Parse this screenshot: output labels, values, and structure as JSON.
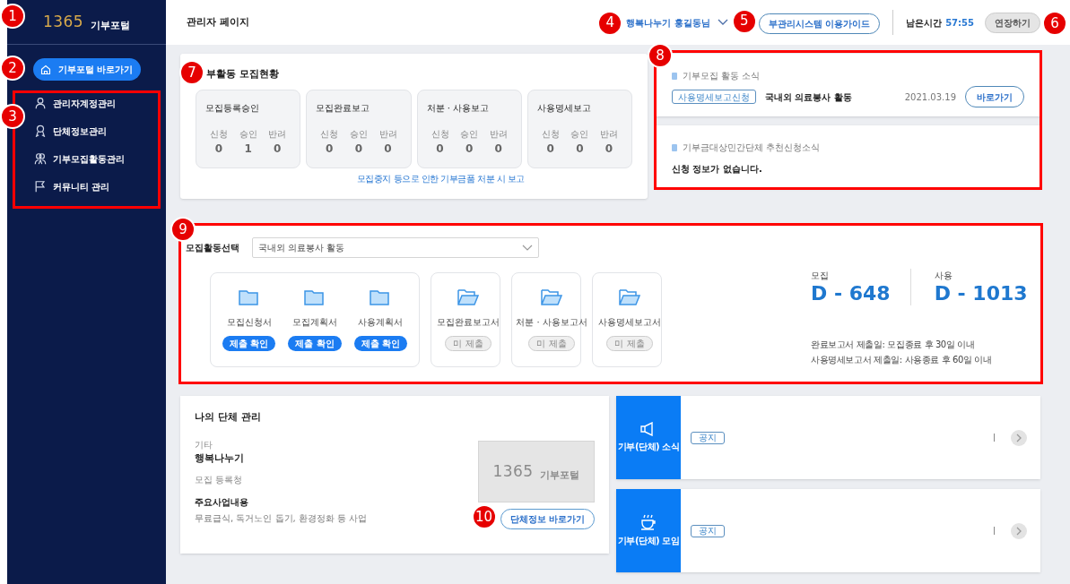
{
  "sidebar": {
    "logo": {
      "number": "1365",
      "text": "기부포털"
    },
    "portal_button": "기부포털 바로가기",
    "menu": [
      {
        "kind": "account",
        "label": "관리자계정관리"
      },
      {
        "kind": "organization",
        "label": "단체정보관리"
      },
      {
        "kind": "campaign",
        "label": "기부모집활동관리"
      },
      {
        "kind": "community",
        "label": "커뮤니티 관리"
      }
    ]
  },
  "header": {
    "title": "관리자 페이지",
    "user": "행복나누기 홍길동님",
    "guide_button": "부관리시스템 이용가이드",
    "remaining_label": "남은시간",
    "remaining_time": "57:55",
    "extend_button": "연장하기"
  },
  "recruitment_status": {
    "title": "부활동 모집현황",
    "groups": [
      {
        "title": "모집등록승인",
        "stats": [
          {
            "label": "신청",
            "value": "0"
          },
          {
            "label": "승인",
            "value": "1"
          },
          {
            "label": "반려",
            "value": "0"
          }
        ]
      },
      {
        "title": "모집완료보고",
        "stats": [
          {
            "label": "신청",
            "value": "0"
          },
          {
            "label": "승인",
            "value": "0"
          },
          {
            "label": "반려",
            "value": "0"
          }
        ]
      },
      {
        "title": "처분 · 사용보고",
        "stats": [
          {
            "label": "신청",
            "value": "0"
          },
          {
            "label": "승인",
            "value": "0"
          },
          {
            "label": "반려",
            "value": "0"
          }
        ]
      },
      {
        "title": "사용명세보고",
        "stats": [
          {
            "label": "신청",
            "value": "0"
          },
          {
            "label": "승인",
            "value": "0"
          },
          {
            "label": "반려",
            "value": "0"
          }
        ]
      }
    ],
    "footnote": "모집중지 등으로 인한 기부금품 처분 시 보고"
  },
  "activity_news": {
    "title": "기부모집 활동 소식",
    "tag": "사용명세보고신청",
    "subject": "국내외 의료봉사 활동",
    "date": "2021.03.19",
    "button": "바로가기"
  },
  "recommendation_news": {
    "title": "기부금대상민간단체 추천신청소식",
    "message": "신청 정보가 없습니다."
  },
  "activity": {
    "select_label": "모집활동선택",
    "select_value": "국내외 의료봉사 활동",
    "document_groups": [
      {
        "documents": [
          {
            "name": "모집신청서",
            "status": "제출 확인",
            "submitted": true
          },
          {
            "name": "모집계획서",
            "status": "제출 확인",
            "submitted": true
          },
          {
            "name": "사용계획서",
            "status": "제출 확인",
            "submitted": true
          }
        ]
      },
      {
        "documents": [
          {
            "name": "모집완료보고서",
            "status": "미 제출",
            "submitted": false
          }
        ]
      },
      {
        "documents": [
          {
            "name": "처분 · 사용보고서",
            "status": "미 제출",
            "submitted": false
          }
        ]
      },
      {
        "documents": [
          {
            "name": "사용명세보고서",
            "status": "미 제출",
            "submitted": false
          }
        ]
      }
    ],
    "d_days": [
      {
        "label": "모집",
        "value": "D - 648"
      },
      {
        "label": "사용",
        "value": "D - 1013"
      }
    ],
    "notes": [
      "완료보고서 제출일: 모집종료 후 30일 이내",
      "사용명세보고서 제출일: 사용종료 후 60일 이내"
    ]
  },
  "organization": {
    "title": "나의 단체 관리",
    "category": "기타",
    "name": "행복나누기",
    "status": "모집 등록청",
    "business_label": "주요사업내용",
    "business": "무료급식, 독거노인 돕기, 환경정화 등 사업",
    "logo": {
      "number": "1365",
      "text": "기부포털"
    },
    "button": "단체정보 바로가기"
  },
  "board_cards": [
    {
      "kind": "news",
      "label": "기부(단체) 소식",
      "tag": "공지"
    },
    {
      "kind": "meeting",
      "label": "기부(단체) 모임",
      "tag": "공지"
    }
  ],
  "annotations": [
    {
      "label": "1"
    },
    {
      "label": "2"
    },
    {
      "label": "3"
    },
    {
      "label": "4"
    },
    {
      "label": "5"
    },
    {
      "label": "6"
    },
    {
      "label": "7"
    },
    {
      "label": "8"
    },
    {
      "label": "9"
    },
    {
      "label": "10"
    }
  ]
}
